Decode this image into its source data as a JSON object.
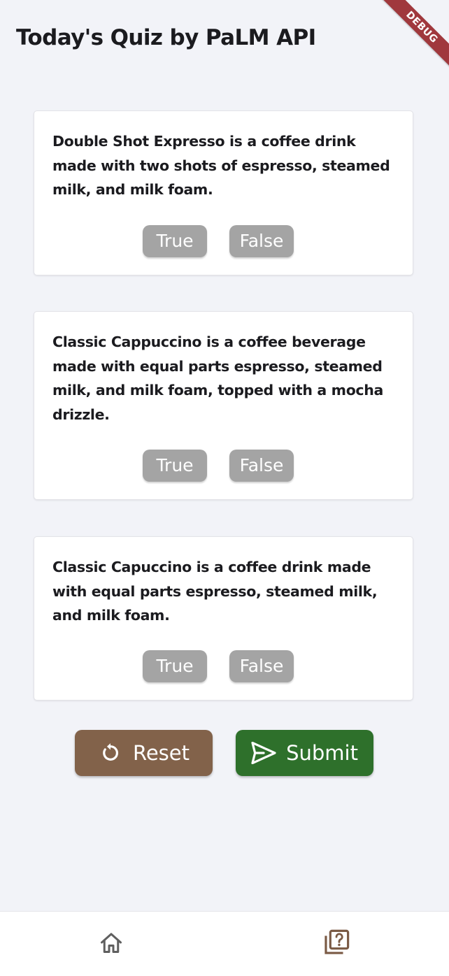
{
  "header": {
    "title": "Today's Quiz by PaLM API",
    "debug_banner": "DEBUG"
  },
  "questions": [
    {
      "text": "Double Shot Expresso is a coffee drink made with two shots of espresso, steamed milk, and milk foam.",
      "true_label": "True",
      "false_label": "False"
    },
    {
      "text": "Classic Cappuccino is a coffee beverage made with equal parts espresso, steamed milk, and milk foam, topped with a mocha drizzle.",
      "true_label": "True",
      "false_label": "False"
    },
    {
      "text": "Classic Capuccino is a coffee drink made with equal parts espresso, steamed milk, and milk foam.",
      "true_label": "True",
      "false_label": "False"
    }
  ],
  "actions": {
    "reset_label": "Reset",
    "reset_icon": "refresh-icon",
    "submit_label": "Submit",
    "submit_icon": "send-icon"
  },
  "nav": {
    "items": [
      {
        "icon": "home-icon",
        "active": false
      },
      {
        "icon": "quiz-icon",
        "active": true
      }
    ]
  },
  "colors": {
    "background": "#f2f3f8",
    "answer_button": "#a4a4a4",
    "reset_button": "#82624a",
    "submit_button": "#2e702b",
    "nav_inactive": "#5f5f5f",
    "nav_active": "#7a5a45",
    "debug_banner": "#a0383d"
  }
}
